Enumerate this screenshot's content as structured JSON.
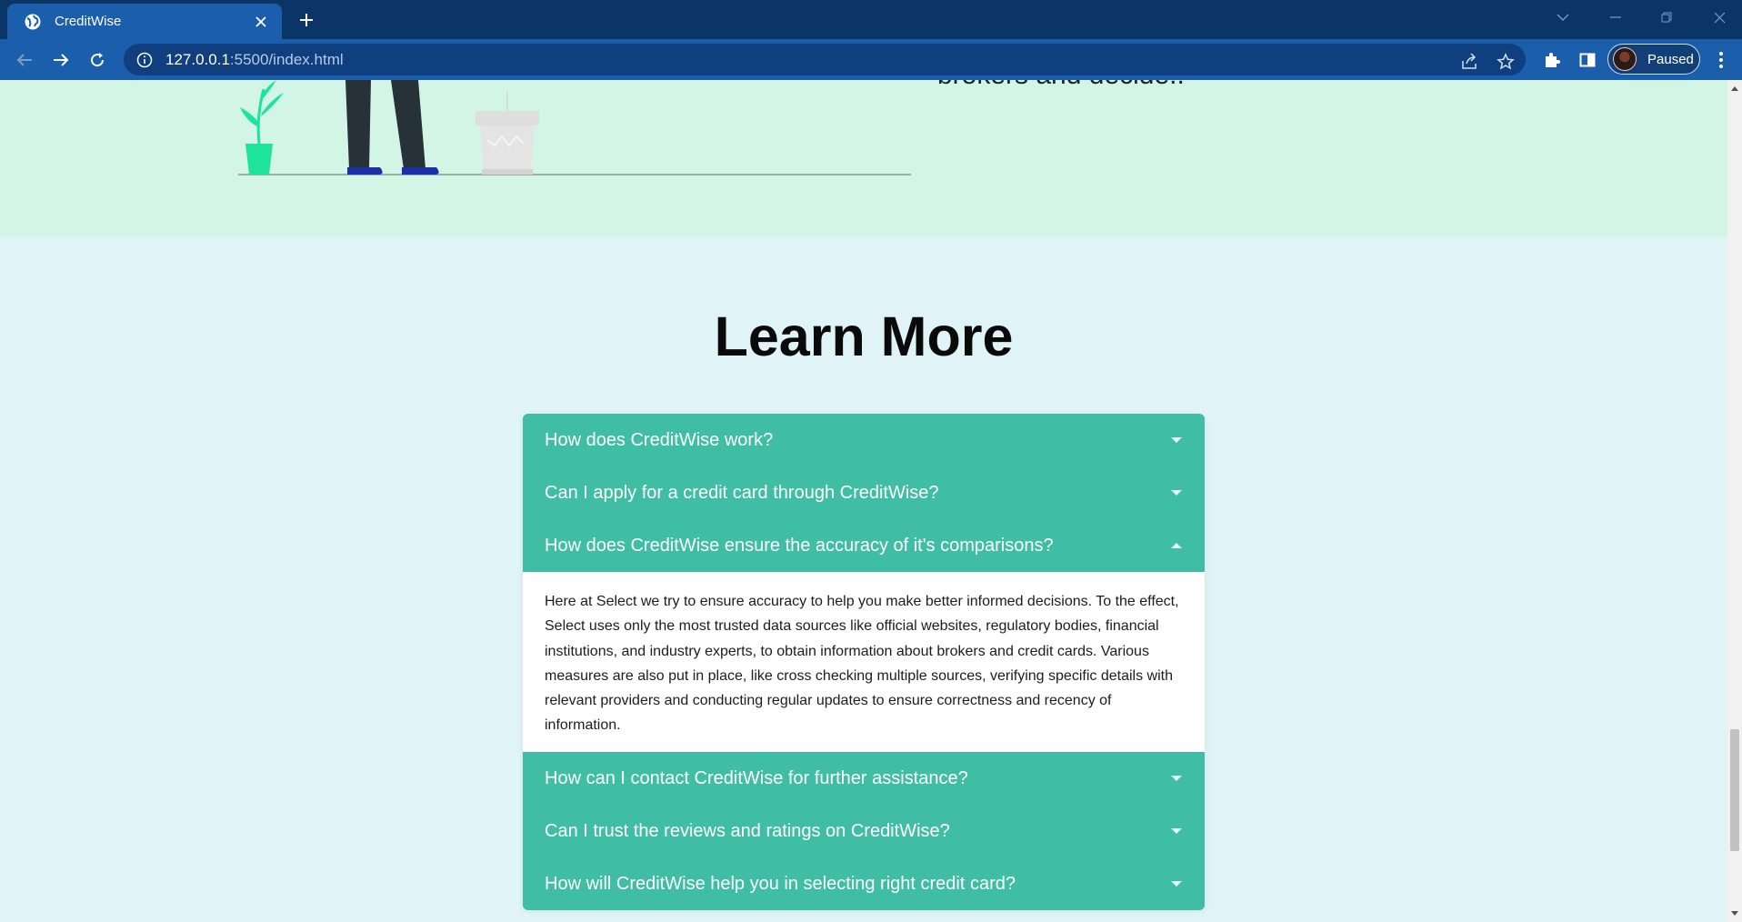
{
  "browser": {
    "tab_title": "CreditWise",
    "url_host": "127.0.0.1",
    "url_path": ":5500/index.html",
    "profile_label": "Paused"
  },
  "hero": {
    "text": "brokers and decide.."
  },
  "learn_more": {
    "title": "Learn More",
    "faqs": [
      {
        "question": "How does CreditWise work?",
        "expanded": false
      },
      {
        "question": "Can I apply for a credit card through CreditWise?",
        "expanded": false
      },
      {
        "question": "How does CreditWise ensure the accuracy of it's comparisons?",
        "expanded": true,
        "answer": "Here at Select we try to ensure accuracy to help you make better informed decisions. To the effect, Select uses only the most trusted data sources like official websites, regulatory bodies, financial institutions, and industry experts, to obtain information about brokers and credit cards. Various measures are also put in place, like cross checking multiple sources, verifying specific details with relevant providers and conducting regular updates to ensure correctness and recency of information."
      },
      {
        "question": "How can I contact CreditWise for further assistance?",
        "expanded": false
      },
      {
        "question": "Can I trust the reviews and ratings on CreditWise?",
        "expanded": false
      },
      {
        "question": "How will CreditWise help you in selecting right credit card?",
        "expanded": false
      }
    ]
  },
  "colors": {
    "accent": "#40bda5",
    "page_bg": "#e0f4f8",
    "hero_bg": "#d2f5e5",
    "browser_frame": "#0b3566"
  }
}
